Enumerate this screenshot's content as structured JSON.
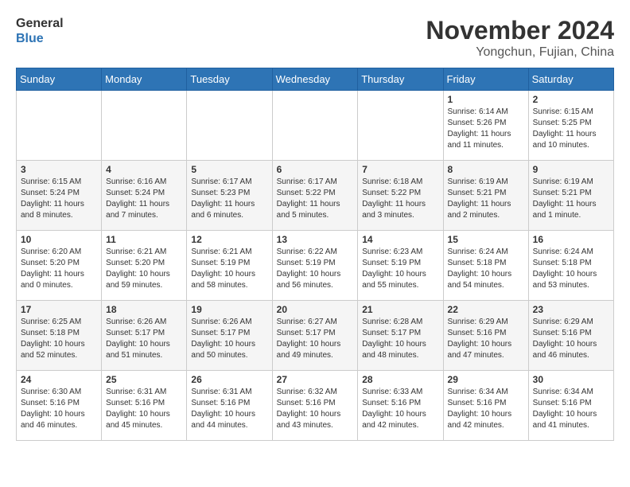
{
  "header": {
    "logo_line1": "General",
    "logo_line2": "Blue",
    "month": "November 2024",
    "location": "Yongchun, Fujian, China"
  },
  "weekdays": [
    "Sunday",
    "Monday",
    "Tuesday",
    "Wednesday",
    "Thursday",
    "Friday",
    "Saturday"
  ],
  "weeks": [
    [
      {
        "day": "",
        "info": ""
      },
      {
        "day": "",
        "info": ""
      },
      {
        "day": "",
        "info": ""
      },
      {
        "day": "",
        "info": ""
      },
      {
        "day": "",
        "info": ""
      },
      {
        "day": "1",
        "info": "Sunrise: 6:14 AM\nSunset: 5:26 PM\nDaylight: 11 hours and 11 minutes."
      },
      {
        "day": "2",
        "info": "Sunrise: 6:15 AM\nSunset: 5:25 PM\nDaylight: 11 hours and 10 minutes."
      }
    ],
    [
      {
        "day": "3",
        "info": "Sunrise: 6:15 AM\nSunset: 5:24 PM\nDaylight: 11 hours and 8 minutes."
      },
      {
        "day": "4",
        "info": "Sunrise: 6:16 AM\nSunset: 5:24 PM\nDaylight: 11 hours and 7 minutes."
      },
      {
        "day": "5",
        "info": "Sunrise: 6:17 AM\nSunset: 5:23 PM\nDaylight: 11 hours and 6 minutes."
      },
      {
        "day": "6",
        "info": "Sunrise: 6:17 AM\nSunset: 5:22 PM\nDaylight: 11 hours and 5 minutes."
      },
      {
        "day": "7",
        "info": "Sunrise: 6:18 AM\nSunset: 5:22 PM\nDaylight: 11 hours and 3 minutes."
      },
      {
        "day": "8",
        "info": "Sunrise: 6:19 AM\nSunset: 5:21 PM\nDaylight: 11 hours and 2 minutes."
      },
      {
        "day": "9",
        "info": "Sunrise: 6:19 AM\nSunset: 5:21 PM\nDaylight: 11 hours and 1 minute."
      }
    ],
    [
      {
        "day": "10",
        "info": "Sunrise: 6:20 AM\nSunset: 5:20 PM\nDaylight: 11 hours and 0 minutes."
      },
      {
        "day": "11",
        "info": "Sunrise: 6:21 AM\nSunset: 5:20 PM\nDaylight: 10 hours and 59 minutes."
      },
      {
        "day": "12",
        "info": "Sunrise: 6:21 AM\nSunset: 5:19 PM\nDaylight: 10 hours and 58 minutes."
      },
      {
        "day": "13",
        "info": "Sunrise: 6:22 AM\nSunset: 5:19 PM\nDaylight: 10 hours and 56 minutes."
      },
      {
        "day": "14",
        "info": "Sunrise: 6:23 AM\nSunset: 5:19 PM\nDaylight: 10 hours and 55 minutes."
      },
      {
        "day": "15",
        "info": "Sunrise: 6:24 AM\nSunset: 5:18 PM\nDaylight: 10 hours and 54 minutes."
      },
      {
        "day": "16",
        "info": "Sunrise: 6:24 AM\nSunset: 5:18 PM\nDaylight: 10 hours and 53 minutes."
      }
    ],
    [
      {
        "day": "17",
        "info": "Sunrise: 6:25 AM\nSunset: 5:18 PM\nDaylight: 10 hours and 52 minutes."
      },
      {
        "day": "18",
        "info": "Sunrise: 6:26 AM\nSunset: 5:17 PM\nDaylight: 10 hours and 51 minutes."
      },
      {
        "day": "19",
        "info": "Sunrise: 6:26 AM\nSunset: 5:17 PM\nDaylight: 10 hours and 50 minutes."
      },
      {
        "day": "20",
        "info": "Sunrise: 6:27 AM\nSunset: 5:17 PM\nDaylight: 10 hours and 49 minutes."
      },
      {
        "day": "21",
        "info": "Sunrise: 6:28 AM\nSunset: 5:17 PM\nDaylight: 10 hours and 48 minutes."
      },
      {
        "day": "22",
        "info": "Sunrise: 6:29 AM\nSunset: 5:16 PM\nDaylight: 10 hours and 47 minutes."
      },
      {
        "day": "23",
        "info": "Sunrise: 6:29 AM\nSunset: 5:16 PM\nDaylight: 10 hours and 46 minutes."
      }
    ],
    [
      {
        "day": "24",
        "info": "Sunrise: 6:30 AM\nSunset: 5:16 PM\nDaylight: 10 hours and 46 minutes."
      },
      {
        "day": "25",
        "info": "Sunrise: 6:31 AM\nSunset: 5:16 PM\nDaylight: 10 hours and 45 minutes."
      },
      {
        "day": "26",
        "info": "Sunrise: 6:31 AM\nSunset: 5:16 PM\nDaylight: 10 hours and 44 minutes."
      },
      {
        "day": "27",
        "info": "Sunrise: 6:32 AM\nSunset: 5:16 PM\nDaylight: 10 hours and 43 minutes."
      },
      {
        "day": "28",
        "info": "Sunrise: 6:33 AM\nSunset: 5:16 PM\nDaylight: 10 hours and 42 minutes."
      },
      {
        "day": "29",
        "info": "Sunrise: 6:34 AM\nSunset: 5:16 PM\nDaylight: 10 hours and 42 minutes."
      },
      {
        "day": "30",
        "info": "Sunrise: 6:34 AM\nSunset: 5:16 PM\nDaylight: 10 hours and 41 minutes."
      }
    ]
  ]
}
